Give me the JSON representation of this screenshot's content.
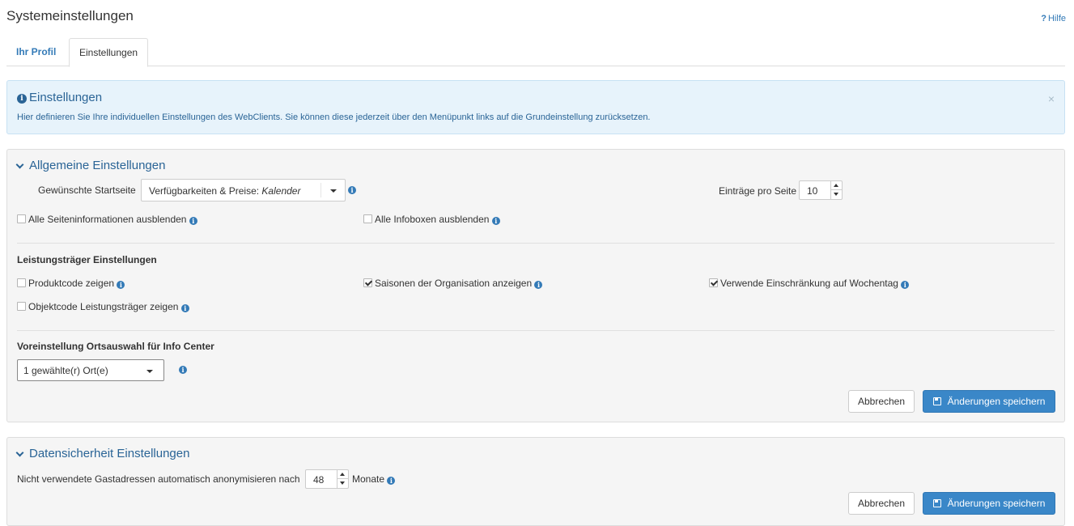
{
  "header": {
    "title": "Systemeinstellungen",
    "help_label": "Hilfe",
    "help_glyph": "?"
  },
  "tabs": [
    {
      "label": "Ihr Profil",
      "active": false
    },
    {
      "label": "Einstellungen",
      "active": true
    }
  ],
  "alert": {
    "title": "Einstellungen",
    "text": "Hier definieren Sie Ihre individuellen Einstellungen des WebClients. Sie können diese jederzeit über den Menüpunkt links auf die Grundeinstellung zurücksetzen.",
    "close": "×"
  },
  "general": {
    "heading": "Allgemeine Einstellungen",
    "start_page_label": "Gewünschte Startseite",
    "start_page_value_prefix": "Verfügbarkeiten & Preise: ",
    "start_page_value_italic": "Kalender",
    "entries_label": "Einträge pro Seite",
    "entries_value": "10",
    "hide_page_info_label": "Alle Seiteninformationen ausblenden",
    "hide_page_info_checked": false,
    "hide_infoboxes_label": "Alle Infoboxen ausblenden",
    "hide_infoboxes_checked": false,
    "provider_section_label": "Leistungsträger Einstellungen",
    "product_code_label": "Produktcode zeigen",
    "product_code_checked": false,
    "seasons_label": "Saisonen der Organisation anzeigen",
    "seasons_checked": true,
    "weekday_label": "Verwende Einschränkung auf Wochentag",
    "weekday_checked": true,
    "object_code_label": "Objektcode Leistungsträger zeigen",
    "object_code_checked": false,
    "location_section_label": "Voreinstellung Ortsauswahl für Info Center",
    "location_value": "1 gewählte(r) Ort(e)",
    "cancel_label": "Abbrechen",
    "save_label": "Änderungen speichern"
  },
  "privacy": {
    "heading": "Datensicherheit Einstellungen",
    "anonymize_prefix": "Nicht verwendete Gastadressen automatisch anonymisieren nach",
    "anonymize_value": "48",
    "anonymize_suffix": "Monate",
    "cancel_label": "Abbrechen",
    "save_label": "Änderungen speichern"
  },
  "colors": {
    "accent": "#337ab7",
    "alert_bg": "#e7f3fb",
    "primary_button": "#3a87c8",
    "panel_bg": "#f5f5f5"
  },
  "icons": {
    "info": "info-circle-icon",
    "save": "floppy-disk-icon",
    "chevron": "chevron-down-icon",
    "close": "close-icon"
  }
}
